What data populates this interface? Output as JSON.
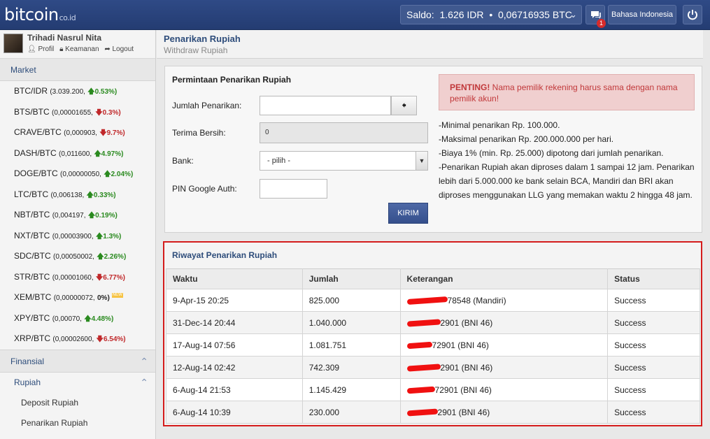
{
  "header": {
    "logo": "bitcoin",
    "logo_sub": "co.id",
    "saldo_label": "Saldo:",
    "saldo_idr": "1.626 IDR",
    "saldo_sep": "•",
    "saldo_btc": "0,06716935 BTC",
    "chat_badge": "1",
    "language": "Bahasa Indonesia"
  },
  "user": {
    "name": "Trihadi Nasrul Nita",
    "links": {
      "profil": "Profil",
      "keamanan": "Keamanan",
      "logout": "Logout"
    }
  },
  "sidebar": {
    "market_title": "Market",
    "markets": [
      {
        "pair": "BTC/IDR",
        "price": "(3.039.200,",
        "change": "0.53%)",
        "dir": "up"
      },
      {
        "pair": "BTS/BTC",
        "price": "(0,00001655,",
        "change": "0.3%)",
        "dir": "down"
      },
      {
        "pair": "CRAVE/BTC",
        "price": "(0,000903,",
        "change": "9.7%)",
        "dir": "down"
      },
      {
        "pair": "DASH/BTC",
        "price": "(0,011600,",
        "change": "4.97%)",
        "dir": "up"
      },
      {
        "pair": "DOGE/BTC",
        "price": "(0,00000050,",
        "change": "2.04%)",
        "dir": "up"
      },
      {
        "pair": "LTC/BTC",
        "price": "(0,006138,",
        "change": "0.33%)",
        "dir": "up"
      },
      {
        "pair": "NBT/BTC",
        "price": "(0,004197,",
        "change": "0.19%)",
        "dir": "up"
      },
      {
        "pair": "NXT/BTC",
        "price": "(0,00003900,",
        "change": "1.3%)",
        "dir": "up"
      },
      {
        "pair": "SDC/BTC",
        "price": "(0,00050002,",
        "change": "2.26%)",
        "dir": "up"
      },
      {
        "pair": "STR/BTC",
        "price": "(0,00001060,",
        "change": "6.77%)",
        "dir": "down"
      },
      {
        "pair": "XEM/BTC",
        "price": "(0,00000072,",
        "change": "0%)",
        "dir": "neutral",
        "tag": "NEW"
      },
      {
        "pair": "XPY/BTC",
        "price": "(0,00070,",
        "change": "4.48%)",
        "dir": "up"
      },
      {
        "pair": "XRP/BTC",
        "price": "(0,00002600,",
        "change": "6.54%)",
        "dir": "down"
      }
    ],
    "finansial": "Finansial",
    "rupiah": "Rupiah",
    "deposit": "Deposit Rupiah",
    "penarikan": "Penarikan Rupiah"
  },
  "page": {
    "title": "Penarikan Rupiah",
    "subtitle": "Withdraw Rupiah"
  },
  "form": {
    "title": "Permintaan Penarikan Rupiah",
    "jumlah_label": "Jumlah Penarikan:",
    "terima_label": "Terima Bersih:",
    "terima_value": "0",
    "bank_label": "Bank:",
    "bank_value": "- pilih -",
    "pin_label": "PIN Google Auth:",
    "submit": "KIRIM"
  },
  "alert": {
    "strong": "PENTING!",
    "text": " Nama pemilik rekening harus sama dengan nama pemilik akun!"
  },
  "info": [
    "-Minimal penarikan Rp. 100.000.",
    "-Maksimal penarikan Rp. 200.000.000 per hari.",
    "-Biaya 1% (min. Rp. 25.000) dipotong dari jumlah penarikan.",
    "-Penarikan Rupiah akan diproses dalam 1 sampai 12 jam. Penarikan lebih dari 5.000.000 ke bank selain BCA, Mandiri dan BRI akan diproses menggunakan LLG yang memakan waktu 2 hingga 48 jam."
  ],
  "history": {
    "title": "Riwayat Penarikan Rupiah",
    "columns": [
      "Waktu",
      "Jumlah",
      "Keterangan",
      "Status"
    ],
    "rows": [
      {
        "waktu": "9-Apr-15 20:25",
        "jumlah": "825.000",
        "ket": "78548 (Mandiri)",
        "status": "Success"
      },
      {
        "waktu": "31-Dec-14 20:44",
        "jumlah": "1.040.000",
        "ket": "2901 (BNI 46)",
        "status": "Success"
      },
      {
        "waktu": "17-Aug-14 07:56",
        "jumlah": "1.081.751",
        "ket": "72901 (BNI 46)",
        "status": "Success"
      },
      {
        "waktu": "12-Aug-14 02:42",
        "jumlah": "742.309",
        "ket": "2901 (BNI 46)",
        "status": "Success"
      },
      {
        "waktu": "6-Aug-14 21:53",
        "jumlah": "1.145.429",
        "ket": "72901 (BNI 46)",
        "status": "Success"
      },
      {
        "waktu": "6-Aug-14 10:39",
        "jumlah": "230.000",
        "ket": "2901 (BNI 46)",
        "status": "Success"
      }
    ]
  }
}
